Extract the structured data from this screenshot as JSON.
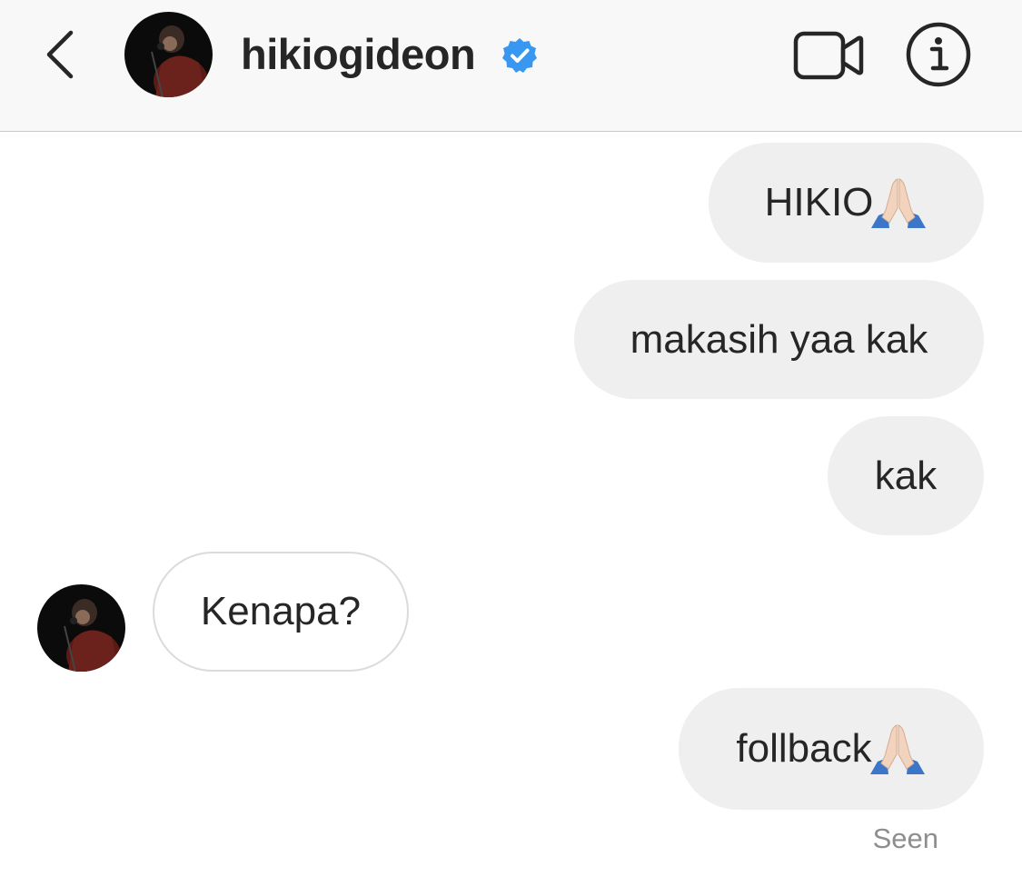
{
  "header": {
    "username": "hikiogideon",
    "verified": true,
    "icons": {
      "back": "chevron-left-icon",
      "verified": "verified-badge-icon",
      "video": "video-camera-icon",
      "info": "info-icon"
    }
  },
  "messages": [
    {
      "from": "me",
      "text": "HIKIO",
      "emoji": "🙏🏻"
    },
    {
      "from": "me",
      "text": "makasih yaa kak"
    },
    {
      "from": "me",
      "text": "kak"
    },
    {
      "from": "them",
      "text": "Kenapa?"
    },
    {
      "from": "me",
      "text": "follback",
      "emoji": "🙏🏻"
    }
  ],
  "status": {
    "seen_label": "Seen"
  },
  "colors": {
    "header_bg": "#f8f8f8",
    "sent_bubble": "#efefef",
    "received_border": "#dbdbdb",
    "verified_blue": "#3897f0",
    "text": "#262626",
    "muted": "#8e8e8e"
  }
}
